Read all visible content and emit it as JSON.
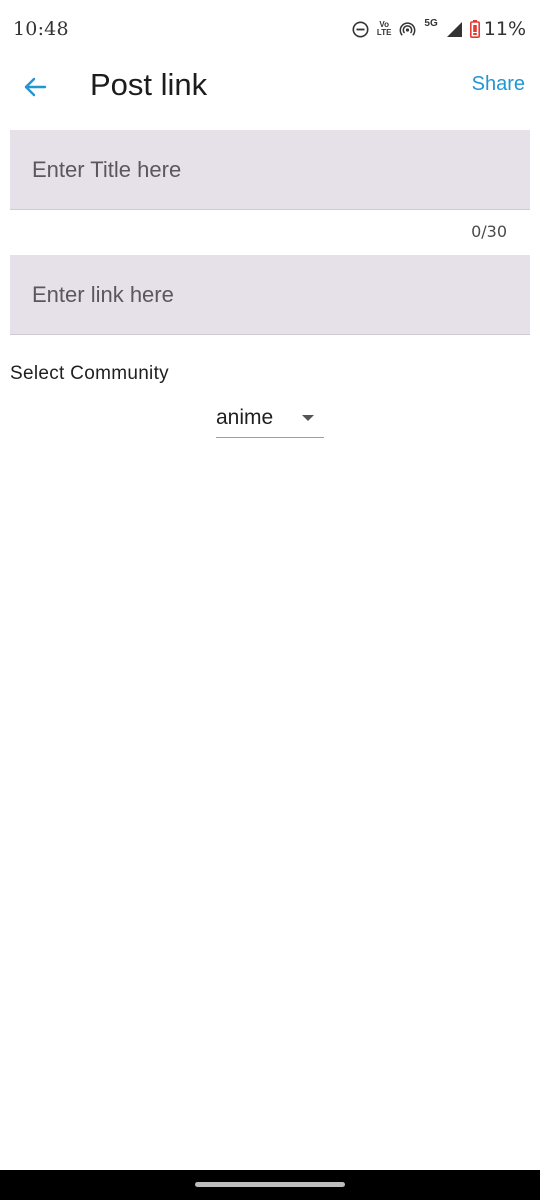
{
  "status_bar": {
    "time": "10:48",
    "network_type": "5G",
    "volte_top": "Vo",
    "volte_bottom": "LTE",
    "battery_percent": "11%",
    "icons": [
      "dnd-icon",
      "volte-icon",
      "hotspot-icon",
      "5g-icon",
      "signal-icon",
      "battery-icon"
    ]
  },
  "app_bar": {
    "title": "Post link",
    "back_icon": "arrow-back-icon",
    "share_label": "Share"
  },
  "form": {
    "title_field": {
      "value": "",
      "placeholder": "Enter Title here",
      "counter": "0/30"
    },
    "link_field": {
      "value": "",
      "placeholder": "Enter link here"
    },
    "community": {
      "label": "Select Community",
      "selected": "anime"
    }
  },
  "colors": {
    "accent": "#2196d3",
    "field_background": "#e6e1e8",
    "battery_low": "#e53935"
  }
}
